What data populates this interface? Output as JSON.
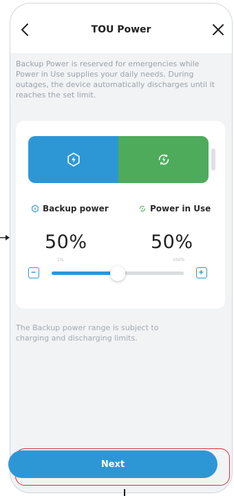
{
  "header": {
    "title": "TOU Power"
  },
  "description": "Backup Power is reserved for emergencies while Power in Use supplies your daily needs. During outages, the device automatically discharges until it reaches the set limit.",
  "split": {
    "backup_label": "Backup power",
    "inuse_label": "Power in Use",
    "backup_value": "50%",
    "inuse_value": "50%",
    "backup_fraction": 0.5
  },
  "slider": {
    "min_label": "1%",
    "max_label": "100%",
    "value_fraction": 0.5
  },
  "note": "The Backup power range is subject to charging and discharging limits.",
  "actions": {
    "next_label": "Next"
  },
  "colors": {
    "backup": "#2d97d6",
    "in_use": "#4fab5c",
    "highlight": "#d9323a"
  },
  "icons": {
    "back": "chevron-left-icon",
    "close": "close-icon",
    "backup": "shield-bolt-icon",
    "in_use": "cycle-bolt-icon",
    "decrease": "minus-icon",
    "increase": "plus-icon"
  }
}
